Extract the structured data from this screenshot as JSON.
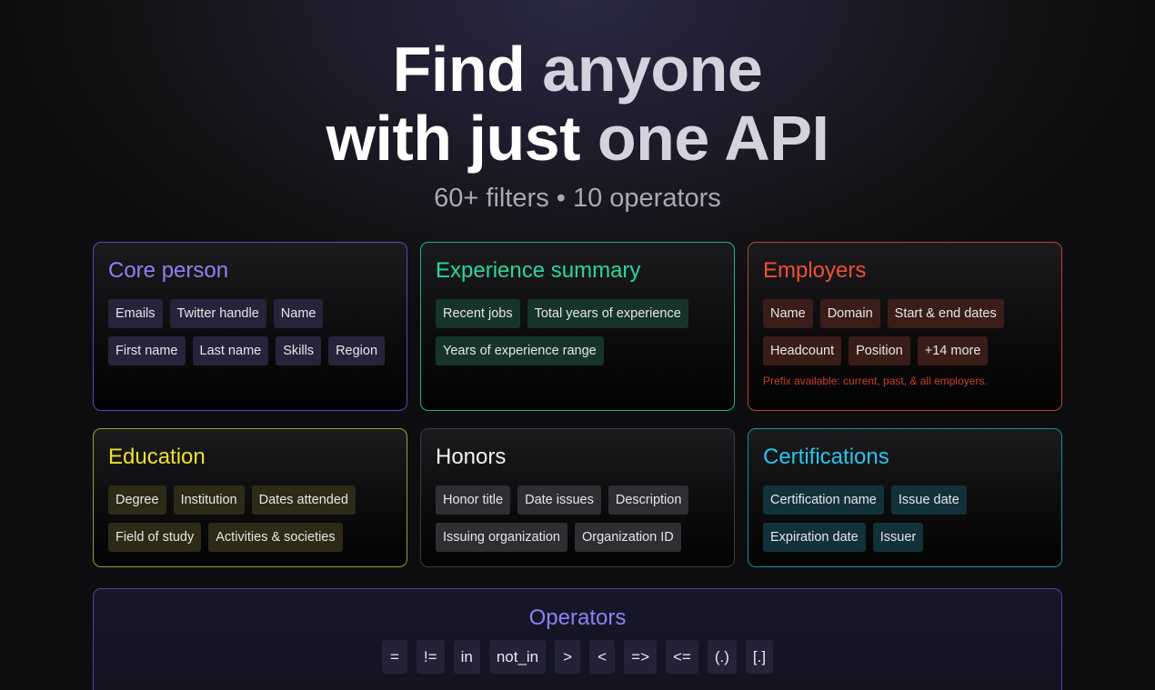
{
  "hero": {
    "line1_a": "Find ",
    "line1_b": "anyone",
    "line2_a": "with just ",
    "line2_b": "one API",
    "subtitle": "60+ filters • 10 operators"
  },
  "cards": {
    "core_person": {
      "title": "Core person",
      "tags": [
        "Emails",
        "Twitter handle",
        "Name",
        "First name",
        "Last name",
        "Skills",
        "Region"
      ],
      "color": "#8c82f2"
    },
    "experience_summary": {
      "title": "Experience summary",
      "tags": [
        "Recent jobs",
        "Total years of experience",
        "Years of experience range"
      ],
      "color": "#27d79e"
    },
    "employers": {
      "title": "Employers",
      "tags": [
        "Name",
        "Domain",
        "Start & end dates",
        "Headcount",
        "Position",
        "+14 more"
      ],
      "note": "Prefix available: current, past, & all employers.",
      "color": "#f0502f"
    },
    "education": {
      "title": "Education",
      "tags": [
        "Degree",
        "Institution",
        "Dates attended",
        "Field of study",
        "Activities & societies"
      ],
      "color": "#f0df2a"
    },
    "honors": {
      "title": "Honors",
      "tags": [
        "Honor title",
        "Date issues",
        "Description",
        "Issuing organization",
        "Organization ID"
      ],
      "color": "#f2f2f4"
    },
    "certifications": {
      "title": "Certifications",
      "tags": [
        "Certification name",
        "Issue date",
        "Expiration date",
        "Issuer"
      ],
      "color": "#28c4e8"
    }
  },
  "operators": {
    "title": "Operators",
    "items": [
      "=",
      "!=",
      "in",
      "not_in",
      ">",
      "<",
      "=>",
      "<=",
      "(.)",
      "[.]"
    ]
  }
}
